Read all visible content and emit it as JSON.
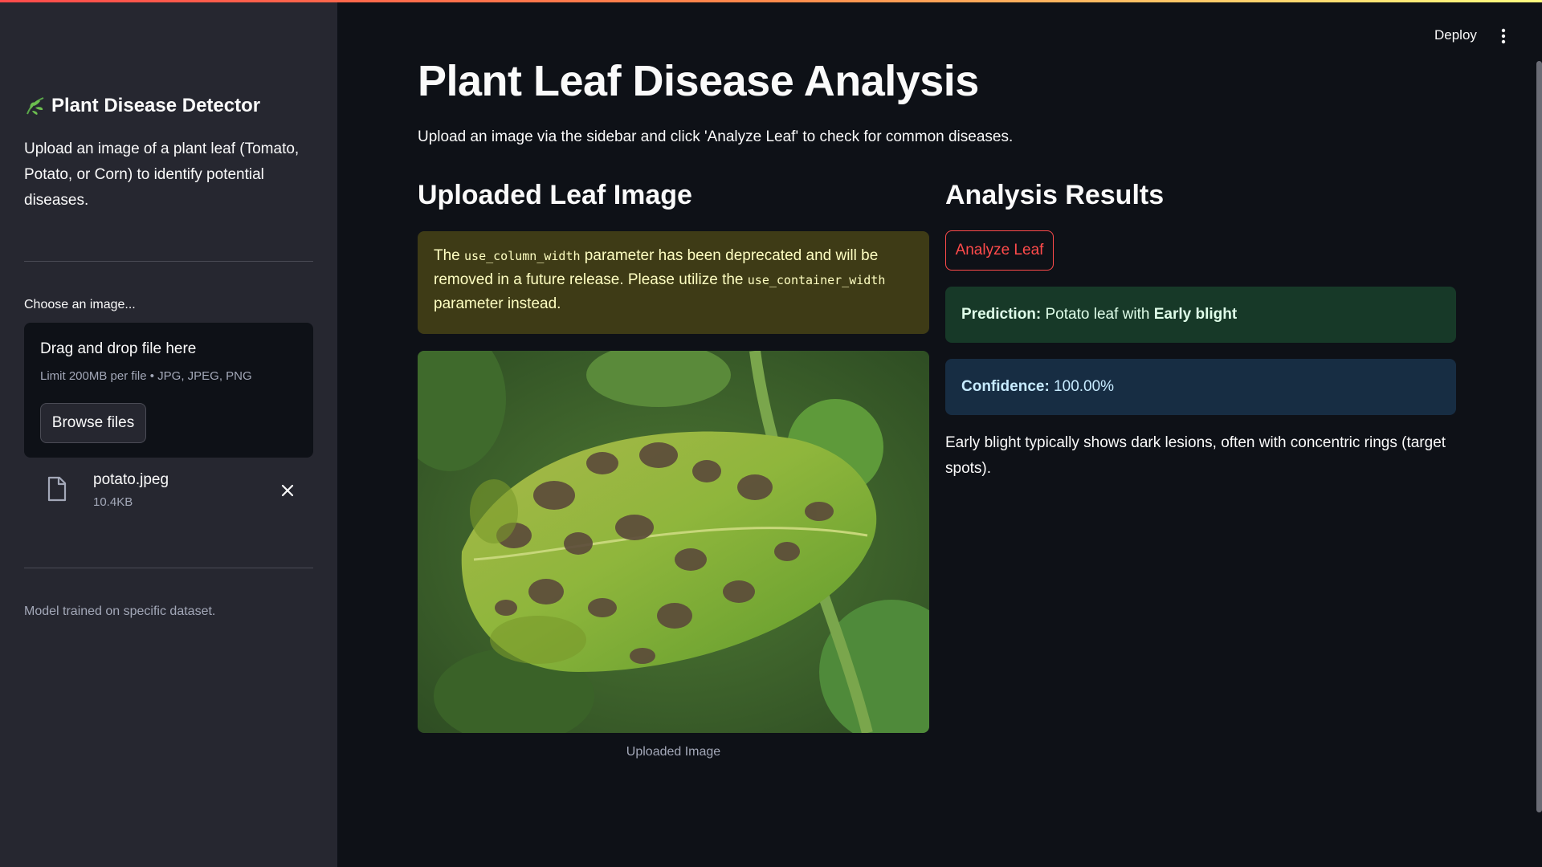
{
  "sidebar": {
    "title": "Plant Disease Detector",
    "description": "Upload an image of a plant leaf (Tomato, Potato, or Corn) to identify potential diseases.",
    "uploader_label": "Choose an image...",
    "dropzone_title": "Drag and drop file here",
    "dropzone_limit": "Limit 200MB per file • JPG, JPEG, PNG",
    "browse_label": "Browse files",
    "file": {
      "name": "potato.jpeg",
      "size": "10.4KB"
    },
    "footer": "Model trained on specific dataset."
  },
  "header": {
    "deploy_label": "Deploy"
  },
  "main": {
    "title": "Plant Leaf Disease Analysis",
    "description": "Upload an image via the sidebar and click 'Analyze Leaf' to check for common diseases.",
    "left_heading": "Uploaded Leaf Image",
    "warning": {
      "pre": "The ",
      "code1": "use_column_width",
      "mid": " parameter has been deprecated and will be removed in a future release. Please utilize the ",
      "code2": "use_container_width",
      "post": " parameter instead."
    },
    "image_caption": "Uploaded Image",
    "right_heading": "Analysis Results",
    "analyze_label": "Analyze Leaf",
    "prediction": {
      "label": "Prediction:",
      "text": " Potato leaf with ",
      "disease": "Early blight"
    },
    "confidence": {
      "label": "Confidence:",
      "value": " 100.00%"
    },
    "result_description": "Early blight typically shows dark lesions, often with concentric rings (target spots)."
  },
  "colors": {
    "accent": "#ff4b4b",
    "sidebar_bg": "#262730",
    "main_bg": "#0e1117",
    "success_bg": "#173928",
    "info_bg": "#172d43",
    "warning_bg": "#3e3b16"
  },
  "icons": {
    "title_icon": "leaf-icon",
    "file_icon": "file-icon",
    "remove_icon": "close-icon",
    "menu_icon": "more-vertical-icon"
  }
}
